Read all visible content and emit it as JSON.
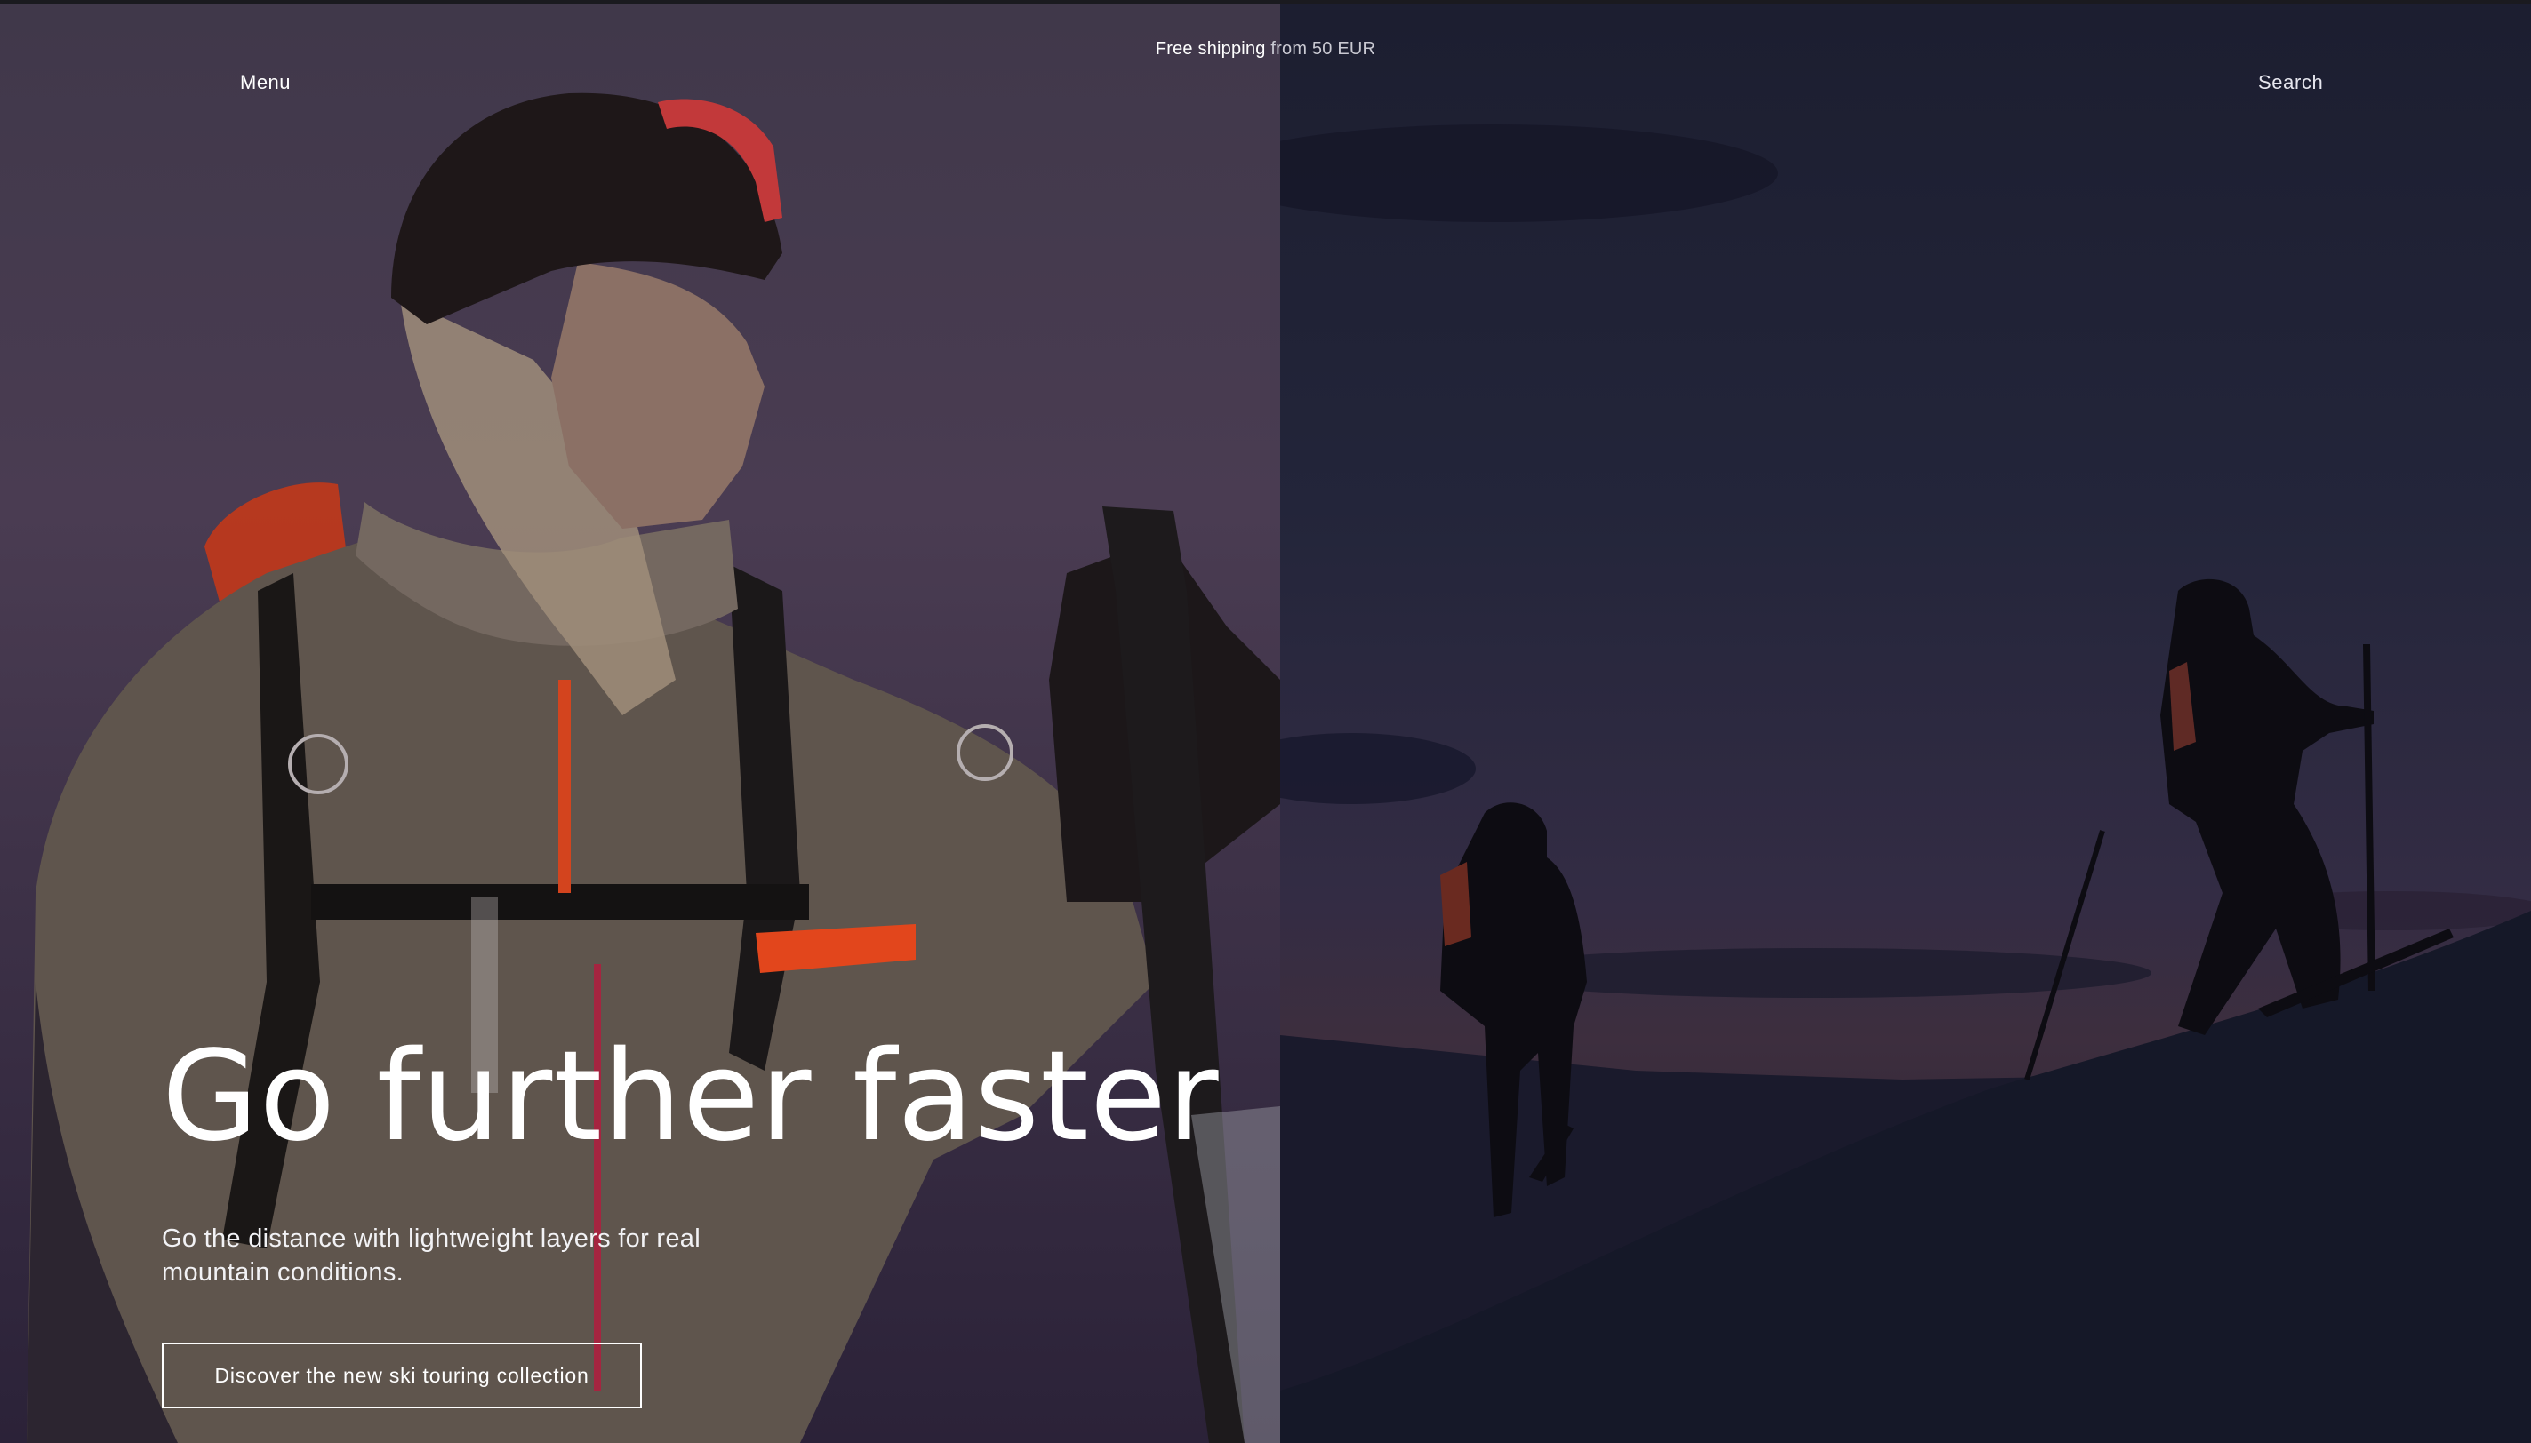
{
  "header": {
    "promo_strong": "Free shipping",
    "promo_light": "from 50 EUR",
    "menu_label": "Menu",
    "search_label": "Search"
  },
  "hero": {
    "title": "Go further faster",
    "subtitle": "Go the distance with lightweight layers for real mountain conditions.",
    "cta_label": "Discover the new ski touring collection"
  },
  "colors": {
    "text": "#ffffff",
    "left_sky": "#40384a",
    "right_sky": "#1c1e30",
    "accent_orange": "#e2461c"
  }
}
